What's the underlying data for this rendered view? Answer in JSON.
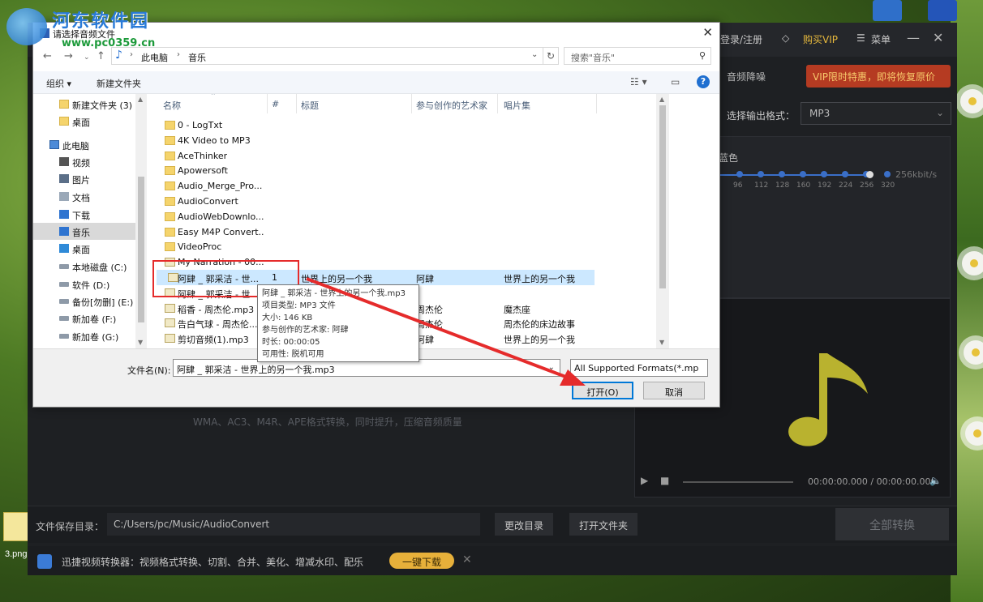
{
  "watermark": {
    "title": "河东软件园",
    "url": "www.pc0359.cn"
  },
  "desktop": {
    "file_label": "3.png"
  },
  "app": {
    "login": "登录/注册",
    "vip": "购买VIP",
    "menu": "菜单",
    "banner": "VIP限时特惠，即将恢复原价",
    "tab_denoise": "音频降噪",
    "output_format_label": "选择输出格式：",
    "output_format_value": "MP3",
    "bitrate_label": "蓝色",
    "bitrate_ticks": [
      "96",
      "112",
      "128",
      "160",
      "192",
      "224",
      "256",
      "320"
    ],
    "bitrate_value": "256kbit/s",
    "time_display": "00:00:00.000 / 00:00:00.000",
    "hint": "WMA、AC3、M4R、APE格式转换，同时提升，压缩音频质量",
    "save_label": "文件保存目录：",
    "save_path": "C:/Users/pc/Music/AudioConvert",
    "change_dir": "更改目录",
    "open_folder": "打开文件夹",
    "convert_all": "全部转换",
    "ad_text": "迅捷视频转换器：视频格式转换、切割、合并、美化、增减水印、配乐",
    "ad_button": "一键下载"
  },
  "dialog": {
    "title": "请选择音频文件",
    "breadcrumb": [
      "此电脑",
      "音乐"
    ],
    "search_placeholder": "搜索\"音乐\"",
    "toolbar": {
      "organize": "组织 ▾",
      "new_folder": "新建文件夹"
    },
    "nav": [
      {
        "label": "新建文件夹 (3)",
        "icon": "folder"
      },
      {
        "label": "桌面",
        "icon": "folder"
      },
      {
        "label": "此电脑",
        "icon": "pc"
      },
      {
        "label": "视频",
        "icon": "video"
      },
      {
        "label": "图片",
        "icon": "picture"
      },
      {
        "label": "文档",
        "icon": "document"
      },
      {
        "label": "下载",
        "icon": "download"
      },
      {
        "label": "音乐",
        "icon": "music",
        "selected": true
      },
      {
        "label": "桌面",
        "icon": "desktop"
      },
      {
        "label": "本地磁盘 (C:)",
        "icon": "drive"
      },
      {
        "label": "软件 (D:)",
        "icon": "drive"
      },
      {
        "label": "备份[勿删] (E:)",
        "icon": "drive"
      },
      {
        "label": "新加卷 (F:)",
        "icon": "drive"
      },
      {
        "label": "新加卷 (G:)",
        "icon": "drive"
      }
    ],
    "columns": [
      "名称",
      "#",
      "标题",
      "参与创作的艺术家",
      "唱片集"
    ],
    "files": [
      {
        "name": "0 - LogTxt",
        "type": "folder"
      },
      {
        "name": "4K Video to MP3",
        "type": "folder"
      },
      {
        "name": "AceThinker",
        "type": "folder"
      },
      {
        "name": "Apowersoft",
        "type": "folder"
      },
      {
        "name": "Audio_Merge_Pro...",
        "type": "folder"
      },
      {
        "name": "AudioConvert",
        "type": "folder"
      },
      {
        "name": "AudioWebDownlo...",
        "type": "folder"
      },
      {
        "name": "Easy M4P Convert...",
        "type": "folder"
      },
      {
        "name": "VideoProc",
        "type": "folder"
      },
      {
        "name": "My Narration - 00...",
        "type": "audio"
      },
      {
        "name": "阿肆 _ 郭采洁 - 世...",
        "type": "audio",
        "num": "1",
        "title": "世界上的另一个我",
        "artist": "阿肆",
        "album": "世界上的另一个我",
        "selected": true
      },
      {
        "name": "阿肆 _ 郭采洁 - 世...",
        "type": "audio"
      },
      {
        "name": "稻香 - 周杰伦.mp3",
        "type": "audio",
        "artist": "周杰伦",
        "album": "魔杰座"
      },
      {
        "name": "告白气球 - 周杰伦...",
        "type": "audio",
        "artist": "周杰伦",
        "album": "周杰伦的床边故事"
      },
      {
        "name": "剪切音频(1).mp3",
        "type": "audio",
        "artist": "阿肆",
        "album": "世界上的另一个我"
      }
    ],
    "tooltip": [
      "阿肆 _ 郭采洁 - 世界上的另一个我.mp3",
      "项目类型: MP3 文件",
      "大小: 146 KB",
      "参与创作的艺术家: 阿肆",
      "时长: 00:00:05",
      "可用性: 脱机可用"
    ],
    "filename_label": "文件名(N):",
    "filename_value": "阿肆 _ 郭采洁 - 世界上的另一个我.mp3",
    "filetype_value": "All Supported Formats(*.mp",
    "open_button": "打开(O)",
    "cancel_button": "取消"
  },
  "colors": {
    "highlight": "#e52b2b",
    "selection": "#cce8ff",
    "banner": "#b53b22",
    "vip": "#e7b93d"
  }
}
